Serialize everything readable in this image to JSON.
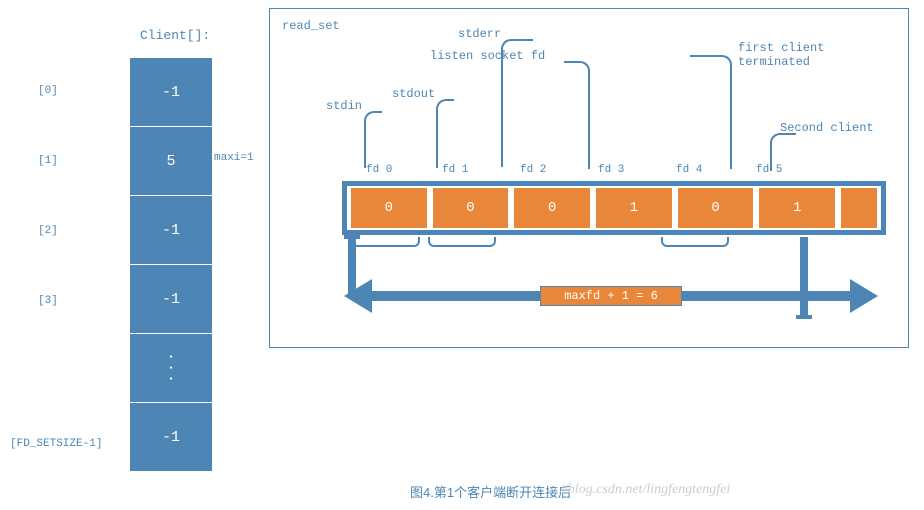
{
  "client_array": {
    "title": "Client[]:",
    "maxi_label": "maxi=1",
    "indices": [
      "[0]",
      "[1]",
      "[2]",
      "[3]",
      "",
      "[FD_SETSIZE-1]"
    ],
    "values": [
      "-1",
      "5",
      "-1",
      "-1",
      "...",
      "-1"
    ]
  },
  "read_set": {
    "title": "read_set",
    "annotations": {
      "stdin": "stdin",
      "stdout": "stdout",
      "stderr": "stderr",
      "listen": "listen socket fd",
      "first_client": "first client\nterminated",
      "second_client": "Second client"
    },
    "fd_labels": [
      "fd 0",
      "fd 1",
      "fd 2",
      "fd 3",
      "fd 4",
      "fd 5"
    ],
    "fd_values": [
      "0",
      "0",
      "0",
      "1",
      "0",
      "1",
      ""
    ],
    "arrow_text": "maxfd + 1 = 6"
  },
  "caption": "图4.第1个客户端断开连接后",
  "watermark": "//blog.csdn.net/lingfengtengfei"
}
